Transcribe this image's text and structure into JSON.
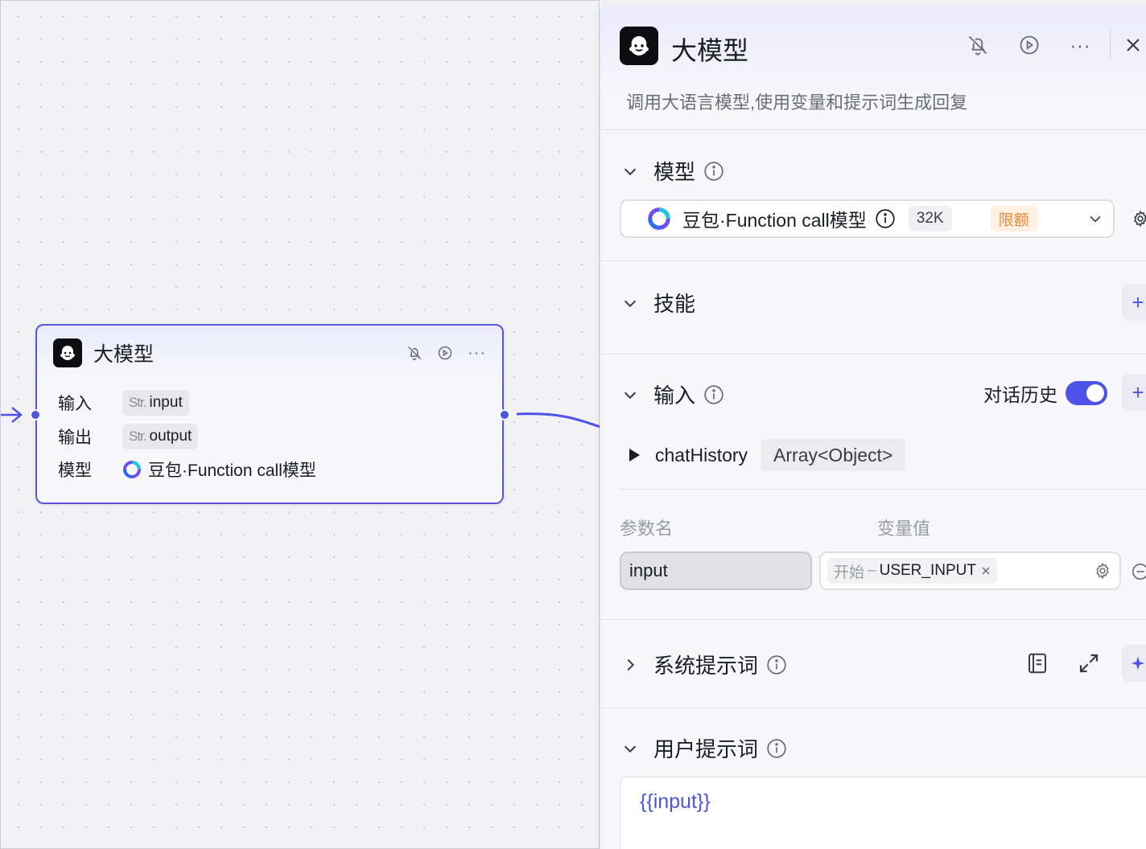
{
  "node": {
    "title": "大模型",
    "rows": [
      {
        "label": "输入",
        "type": "Str.",
        "value": "input"
      },
      {
        "label": "输出",
        "type": "Str.",
        "value": "output"
      },
      {
        "label": "模型",
        "value": "豆包·Function call模型"
      }
    ]
  },
  "panel": {
    "title": "大模型",
    "description": "调用大语言模型,使用变量和提示词生成回复",
    "model_section": {
      "title": "模型",
      "selected_model": "豆包·Function call模型",
      "context": "32K",
      "limit_badge": "限额"
    },
    "skills_section": {
      "title": "技能"
    },
    "input_section": {
      "title": "输入",
      "history_label": "对话历史",
      "history_enabled": true,
      "chat_history": {
        "name": "chatHistory",
        "type": "Array<Object>"
      },
      "param_header": "参数名",
      "value_header": "变量值",
      "param_name": "input",
      "value_source": "开始",
      "value_separator": "–",
      "value_var": "USER_INPUT"
    },
    "system_prompt_section": {
      "title": "系统提示词"
    },
    "user_prompt_section": {
      "title": "用户提示词",
      "content": "{{input}}"
    }
  },
  "colors": {
    "accent": "#4d53e8",
    "limit_text": "#f28a35",
    "limit_bg": "#fff0e2"
  }
}
